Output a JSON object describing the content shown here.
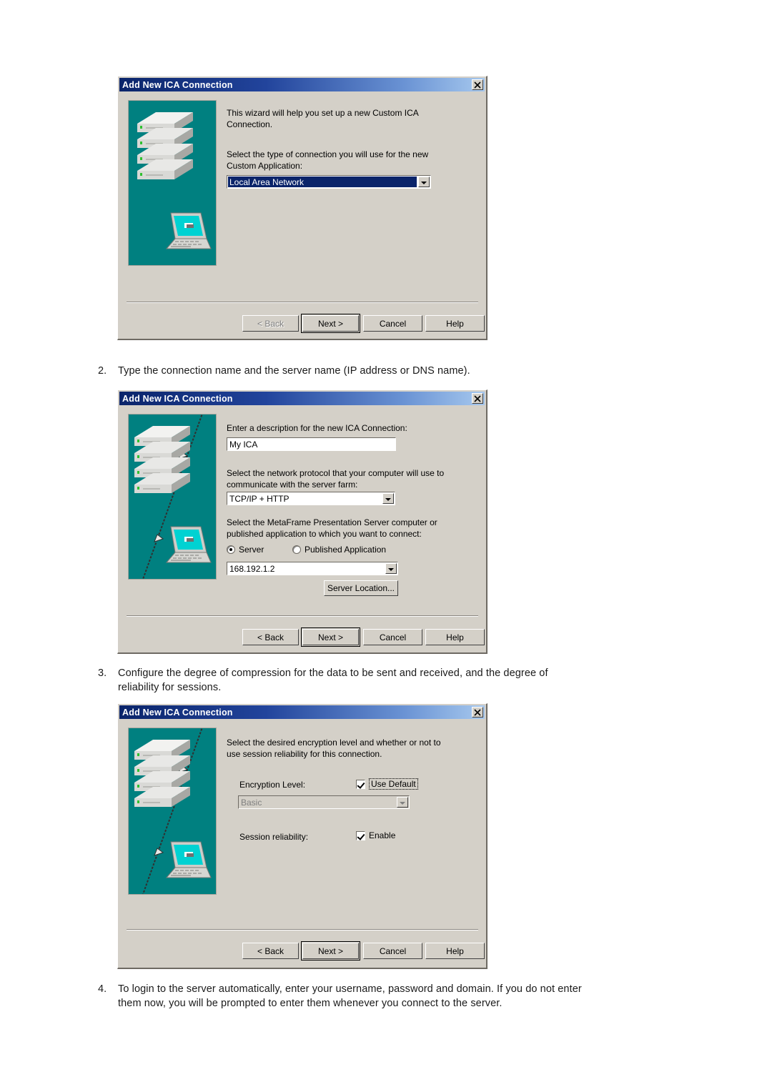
{
  "document": {
    "steps": [
      {
        "number": "2.",
        "text": "Type the connection name and the server name (IP address or DNS name)."
      },
      {
        "number": "3.",
        "text": "Configure the degree of compression for the data to be sent and received, and the degree of reliability for sessions."
      },
      {
        "number": "4.",
        "text": "To login to the server automatically, enter your username, password and domain. If you do not enter them now, you will be prompted to enter them whenever you connect to the server."
      }
    ]
  },
  "colors": {
    "title_bar_start": "#0a246a",
    "title_bar_end": "#a6c8ee",
    "dialog_face": "#d4d0c8",
    "illustration_background": "#008080",
    "selection": "#0a246a",
    "laptop_screen": "#00d2d2"
  },
  "dialog1": {
    "title": "Add New ICA Connection",
    "close_label": "close-icon",
    "intro_text": "This wizard will help you set up a new Custom ICA\nConnection.",
    "prompt_text": "Select the type of connection you will use for the new\nCustom Application:",
    "connection_type": {
      "value": "Local Area Network",
      "selected": true
    },
    "buttons": {
      "back": "< Back",
      "next": "Next >",
      "cancel": "Cancel",
      "help": "Help",
      "back_enabled": false
    }
  },
  "dialog2": {
    "title": "Add New ICA Connection",
    "close_label": "close-icon",
    "description_label": "Enter a description for the new ICA Connection:",
    "description_value": "My ICA",
    "protocol_label": "Select the network protocol that your computer will use to\ncommunicate with the server farm:",
    "protocol_value": "TCP/IP + HTTP",
    "target_label": "Select the MetaFrame Presentation Server computer or\npublished application to which you want to connect:",
    "radio_server": "Server",
    "radio_published_application": "Published Application",
    "radio_selected": "server",
    "server_value": "168.192.1.2",
    "server_location_button": "Server Location...",
    "buttons": {
      "back": "< Back",
      "next": "Next >",
      "cancel": "Cancel",
      "help": "Help",
      "back_enabled": true
    }
  },
  "dialog3": {
    "title": "Add New ICA Connection",
    "close_label": "close-icon",
    "intro_text": "Select the desired encryption level and whether or not to\nuse session reliability for this connection.",
    "encryption_label": "Encryption Level:",
    "use_default_label": "Use Default",
    "use_default_checked": true,
    "encryption_value": "Basic",
    "encryption_enabled": false,
    "session_reliability_label": "Session reliability:",
    "enable_label": "Enable",
    "enable_checked": true,
    "buttons": {
      "back": "< Back",
      "next": "Next >",
      "cancel": "Cancel",
      "help": "Help",
      "back_enabled": true
    }
  }
}
